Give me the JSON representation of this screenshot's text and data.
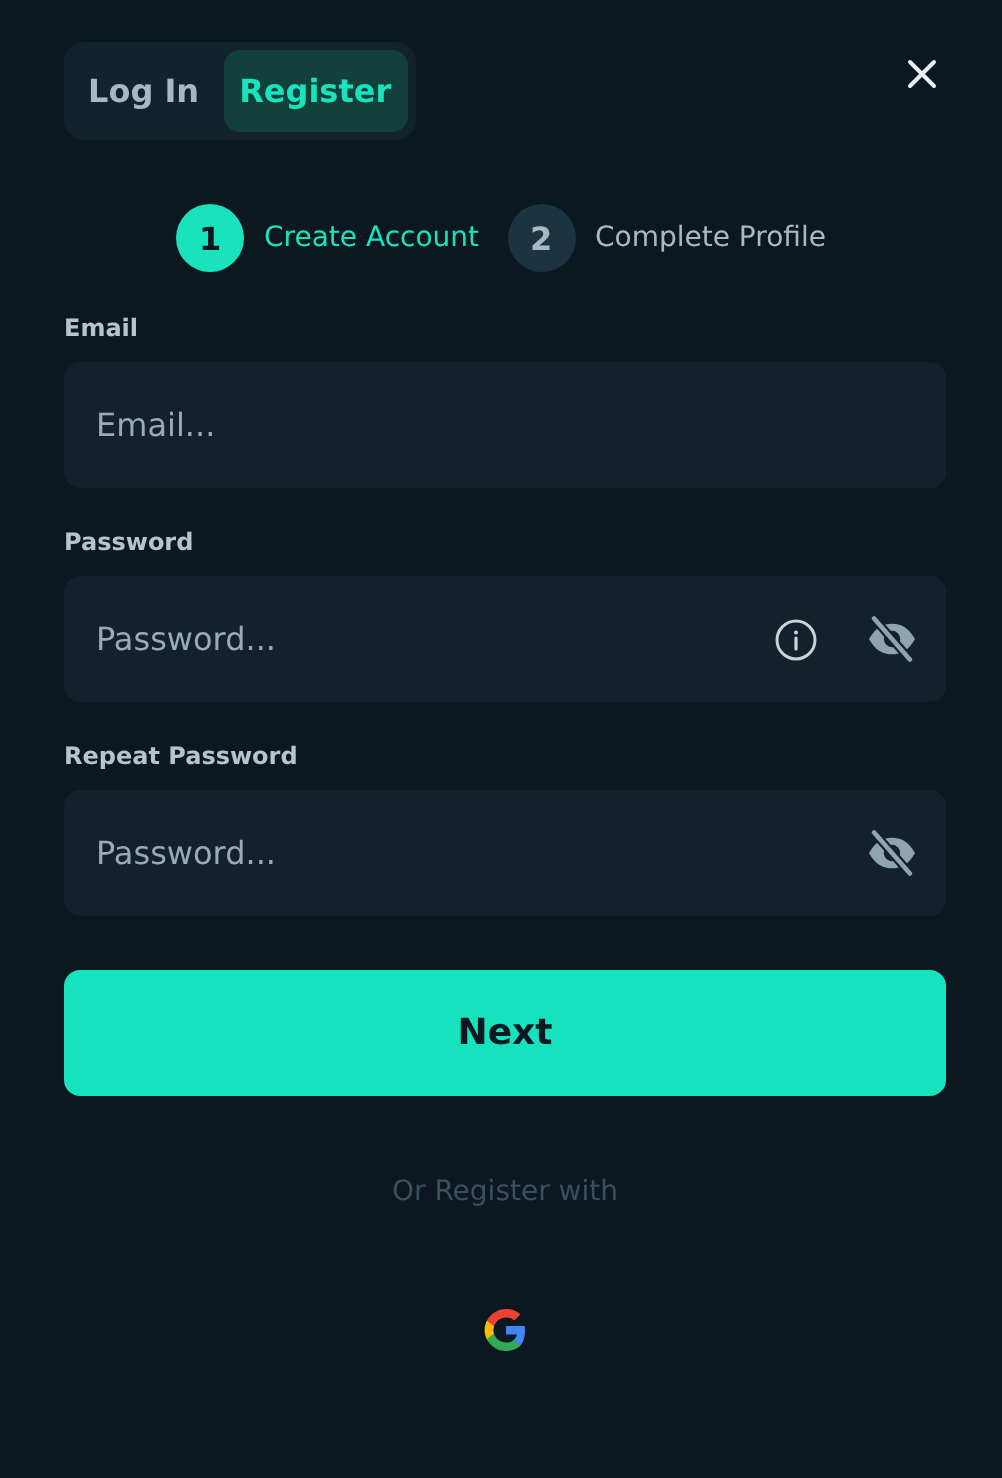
{
  "tabs": [
    {
      "label": "Log In",
      "selected": false
    },
    {
      "label": "Register",
      "selected": true
    }
  ],
  "steps": [
    {
      "number": "1",
      "label": "Create Account",
      "selected": true
    },
    {
      "number": "2",
      "label": "Complete Profile",
      "selected": false
    }
  ],
  "fields": [
    {
      "label": "Email",
      "placeholder": "Email...",
      "info": false,
      "reveal": false
    },
    {
      "label": "Password",
      "placeholder": "Password...",
      "info": true,
      "reveal": true
    },
    {
      "label": "Repeat Password",
      "placeholder": "Password...",
      "info": false,
      "reveal": true
    }
  ],
  "submit": "Next",
  "alt_text": "Or Register with"
}
